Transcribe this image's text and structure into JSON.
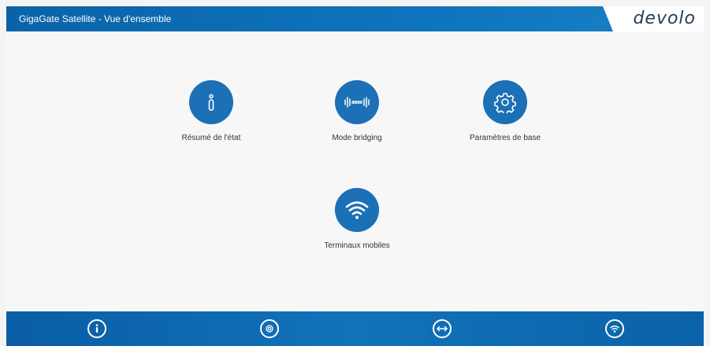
{
  "header": {
    "title": "GigaGate Satellite - Vue d'ensemble",
    "brand": "devolo"
  },
  "tiles": [
    {
      "label": "Résumé de l'état",
      "icon": "info-icon"
    },
    {
      "label": "Mode bridging",
      "icon": "bridging-icon"
    },
    {
      "label": "Paramètres de base",
      "icon": "gear-icon"
    },
    {
      "label": "Terminaux mobiles",
      "icon": "wifi-icon"
    }
  ],
  "footer": {
    "buttons": [
      {
        "icon": "info-icon"
      },
      {
        "icon": "gear-icon"
      },
      {
        "icon": "bridging-icon"
      },
      {
        "icon": "wifi-icon"
      }
    ]
  },
  "colors": {
    "accent": "#1b70b6",
    "header_bar": "#0e74bd",
    "footer_bar": "#1172ba",
    "brand_text": "#1f3d57"
  }
}
